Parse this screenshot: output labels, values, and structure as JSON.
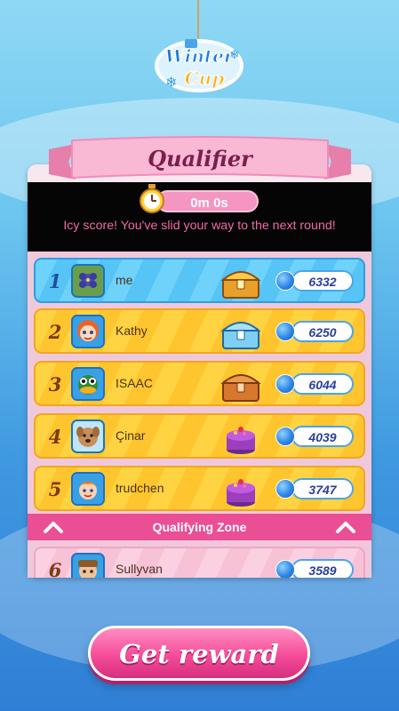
{
  "logo": {
    "line1": "Winter",
    "line2": "Cup"
  },
  "panel": {
    "title": "Qualifier",
    "timer": "0m 0s",
    "message": "Icy score! You've slid your way to the next round!"
  },
  "leaderboard": [
    {
      "rank": "1",
      "name": "me",
      "score": "6332",
      "reward": "gold-chest-icon",
      "style": "blue",
      "avatar": "flower-avatar"
    },
    {
      "rank": "2",
      "name": "Kathy",
      "score": "6250",
      "reward": "silver-chest-icon",
      "style": "gold",
      "avatar": "girl-avatar"
    },
    {
      "rank": "3",
      "name": "ISAAC",
      "score": "6044",
      "reward": "bronze-chest-icon",
      "style": "gold",
      "avatar": "duck-avatar"
    },
    {
      "rank": "4",
      "name": "Çinar",
      "score": "4039",
      "reward": "cake-icon",
      "style": "gold",
      "avatar": "dog-avatar"
    },
    {
      "rank": "5",
      "name": "trudchen",
      "score": "3747",
      "reward": "cake-icon",
      "style": "gold",
      "avatar": "boy-avatar"
    },
    {
      "rank": "6",
      "name": "Sullyvan",
      "score": "3589",
      "reward": "",
      "style": "pink",
      "avatar": "old-man-avatar"
    }
  ],
  "zone_label": "Qualifying Zone",
  "cta": {
    "label": "Get reward"
  },
  "colors": {
    "accent_pink": "#f54c9a",
    "row_gold": "#ffd341",
    "row_blue": "#6ed2fb",
    "score_text": "#2b3f9a"
  }
}
